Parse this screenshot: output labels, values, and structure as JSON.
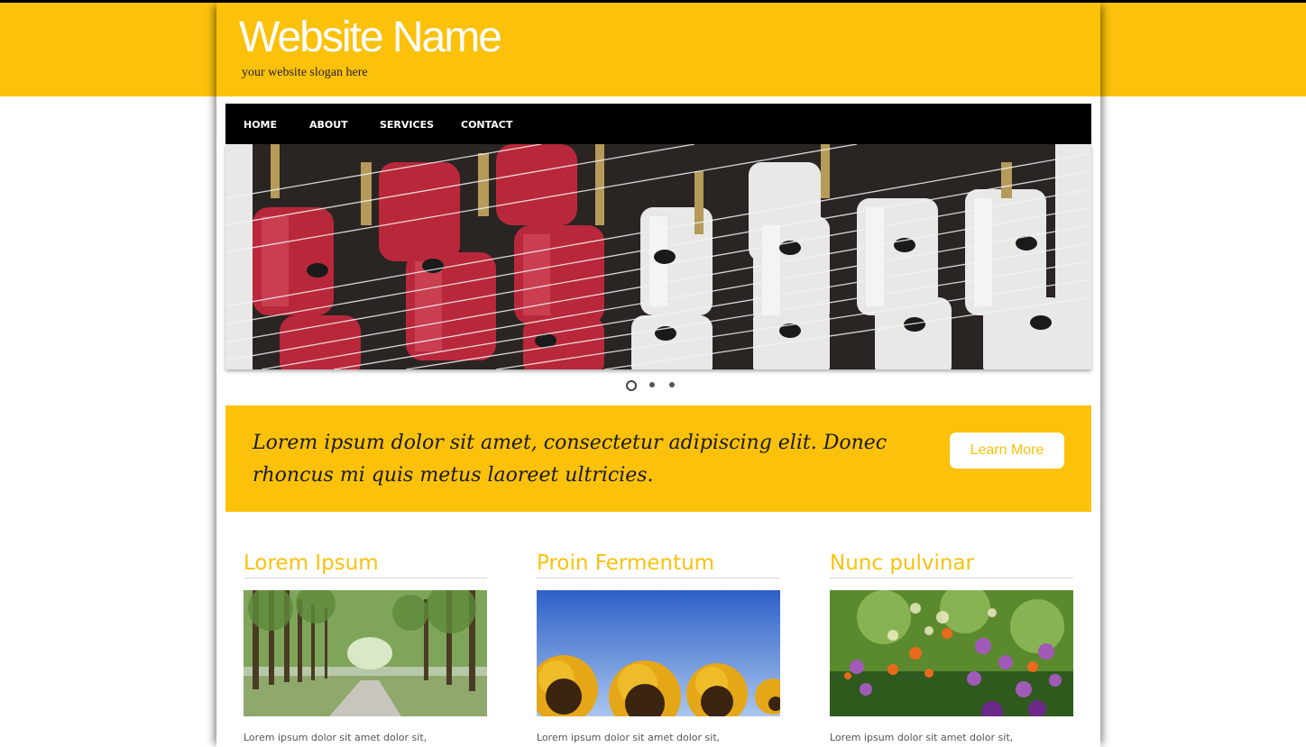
{
  "header": {
    "site_name": "Website Name",
    "slogan": "your website slogan here"
  },
  "nav": {
    "items": [
      {
        "label": "HOME"
      },
      {
        "label": "ABOUT"
      },
      {
        "label": "SERVICES"
      },
      {
        "label": "CONTACT"
      }
    ]
  },
  "slider": {
    "image": "textile-spools-image",
    "slide_count": 3,
    "active_index": 0
  },
  "banner": {
    "text": "Lorem ipsum dolor sit amet, consectetur adipiscing elit. Donec rhoncus mi quis metus laoreet ultricies.",
    "button_label": "Learn More"
  },
  "columns": [
    {
      "title": "Lorem Ipsum",
      "image": "tree-lined-road-image",
      "text": "Lorem ipsum dolor sit amet dolor sit,"
    },
    {
      "title": "Proin Fermentum",
      "image": "sunflowers-image",
      "text": "Lorem ipsum dolor sit amet dolor sit,"
    },
    {
      "title": "Nunc pulvinar",
      "image": "wildflowers-image",
      "text": "Lorem ipsum dolor sit amet dolor sit,"
    }
  ],
  "colors": {
    "accent": "#fbc10b",
    "nav_bg": "#000000",
    "title_text": "#ffffff"
  }
}
